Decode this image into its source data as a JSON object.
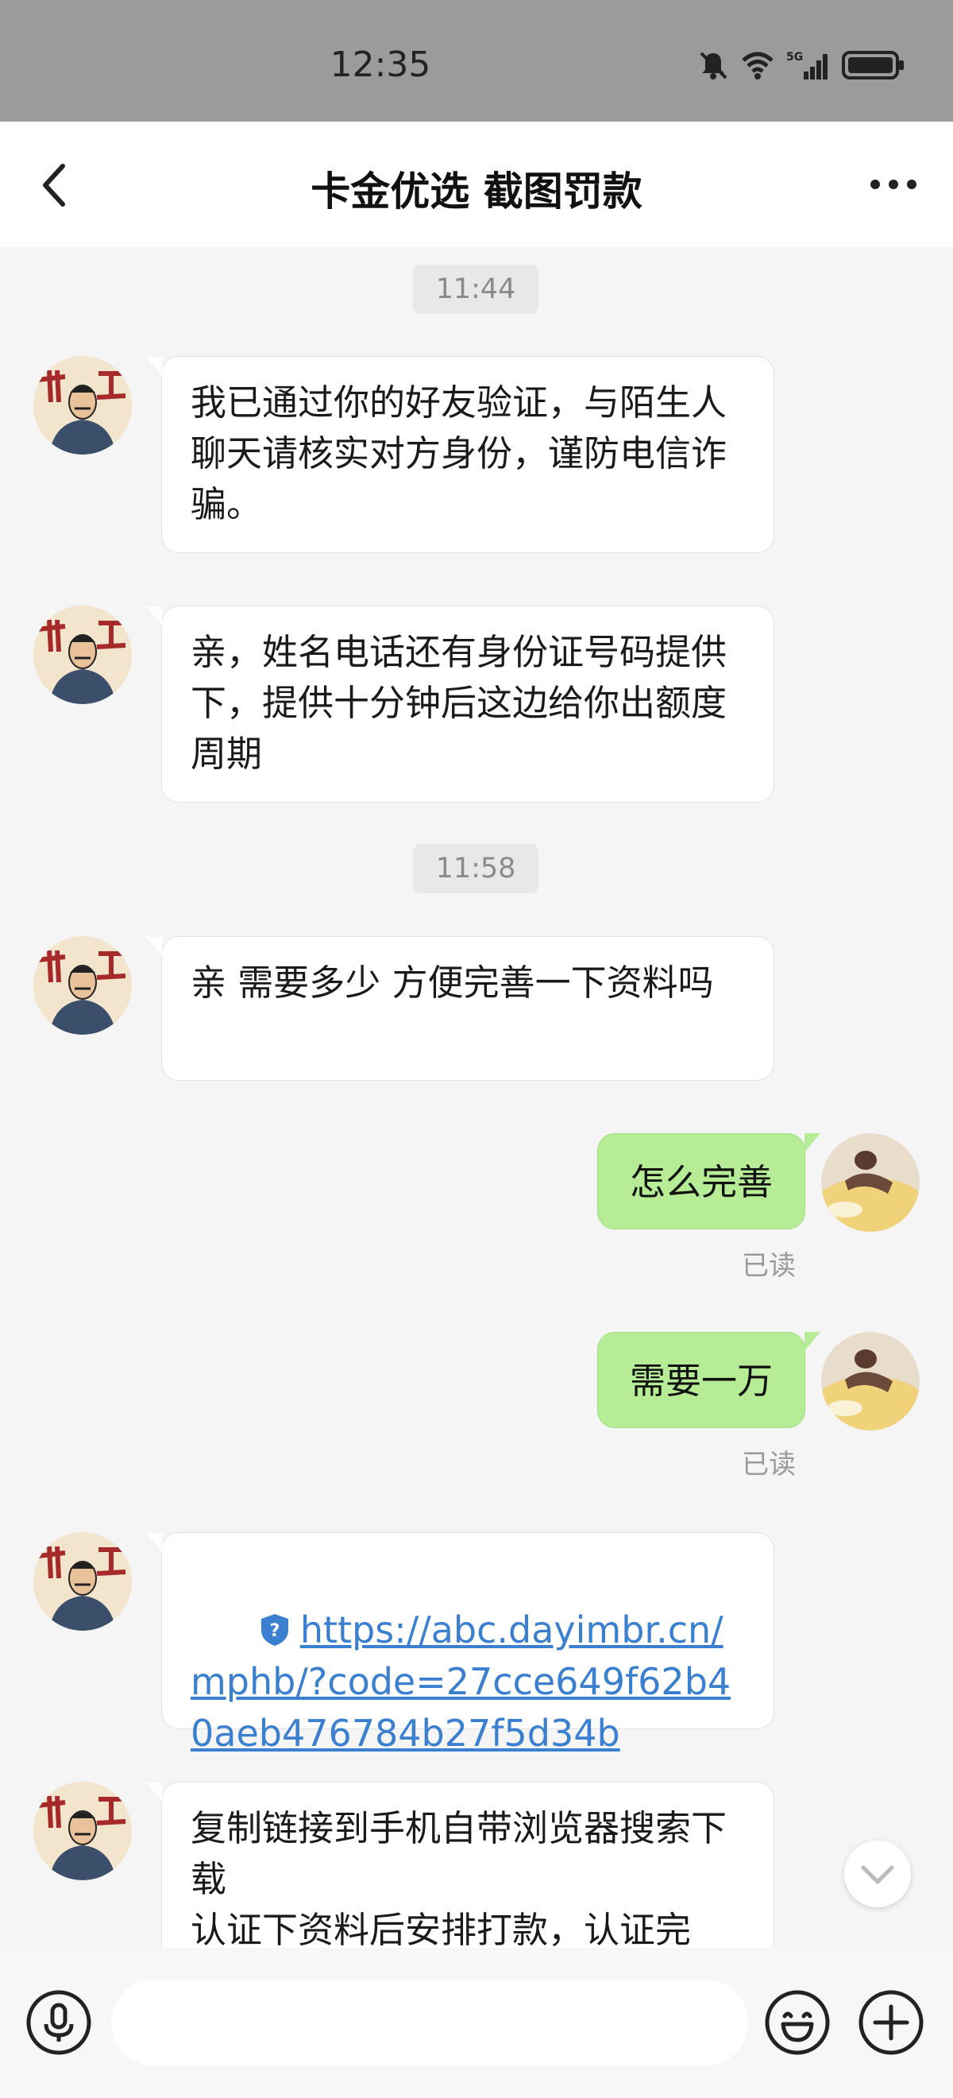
{
  "status_bar": {
    "time": "12:35",
    "network": "5G"
  },
  "header": {
    "title": "卡金优选 截图罚款",
    "back_icon": "chevron-left-icon",
    "more_icon": "more-dots-icon"
  },
  "messages": {
    "ts1": "11:44",
    "m1": "我已通过你的好友验证，与陌生人聊天请核实对方身份，谨防电信诈骗。",
    "m2": "亲，姓名电话还有身份证号码提供下，提供十分钟后这边给你出额度周期",
    "ts2": "11:58",
    "m3": "亲 需要多少 方便完善一下资料吗",
    "r1": "怎么完善",
    "r1_status": "已读",
    "r2": "需要一万",
    "r2_status": "已读",
    "link": "https://abc.dayimbr.cn/mphb/?code=27cce649f62b40aeb476784b27f5d34b",
    "m5": "复制链接到手机自带浏览器搜索下载\n认证下资料后安排打款，认证完"
  },
  "input": {
    "placeholder": "",
    "value": ""
  },
  "colors": {
    "accent_green": "#b5ec95",
    "link_blue": "#3a7fd0",
    "status_bar_bg": "#9b9b9b"
  }
}
